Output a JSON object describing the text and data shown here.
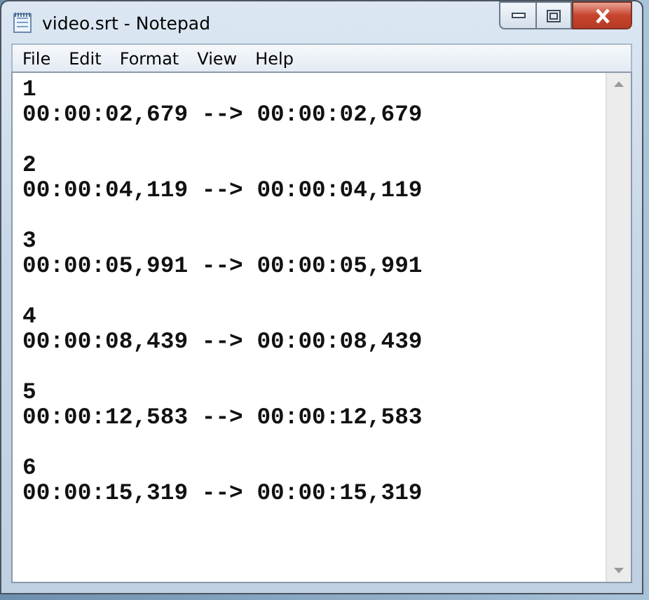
{
  "window": {
    "title": "video.srt - Notepad"
  },
  "menu": [
    {
      "label": "File"
    },
    {
      "label": "Edit"
    },
    {
      "label": "Format"
    },
    {
      "label": "View"
    },
    {
      "label": "Help"
    }
  ],
  "entries": [
    {
      "number": "1",
      "timing": "00:00:02,679 --> 00:00:02,679"
    },
    {
      "number": "2",
      "timing": "00:00:04,119 --> 00:00:04,119"
    },
    {
      "number": "3",
      "timing": "00:00:05,991 --> 00:00:05,991"
    },
    {
      "number": "4",
      "timing": "00:00:08,439 --> 00:00:08,439"
    },
    {
      "number": "5",
      "timing": "00:00:12,583 --> 00:00:12,583"
    },
    {
      "number": "6",
      "timing": "00:00:15,319 --> 00:00:15,319"
    }
  ]
}
